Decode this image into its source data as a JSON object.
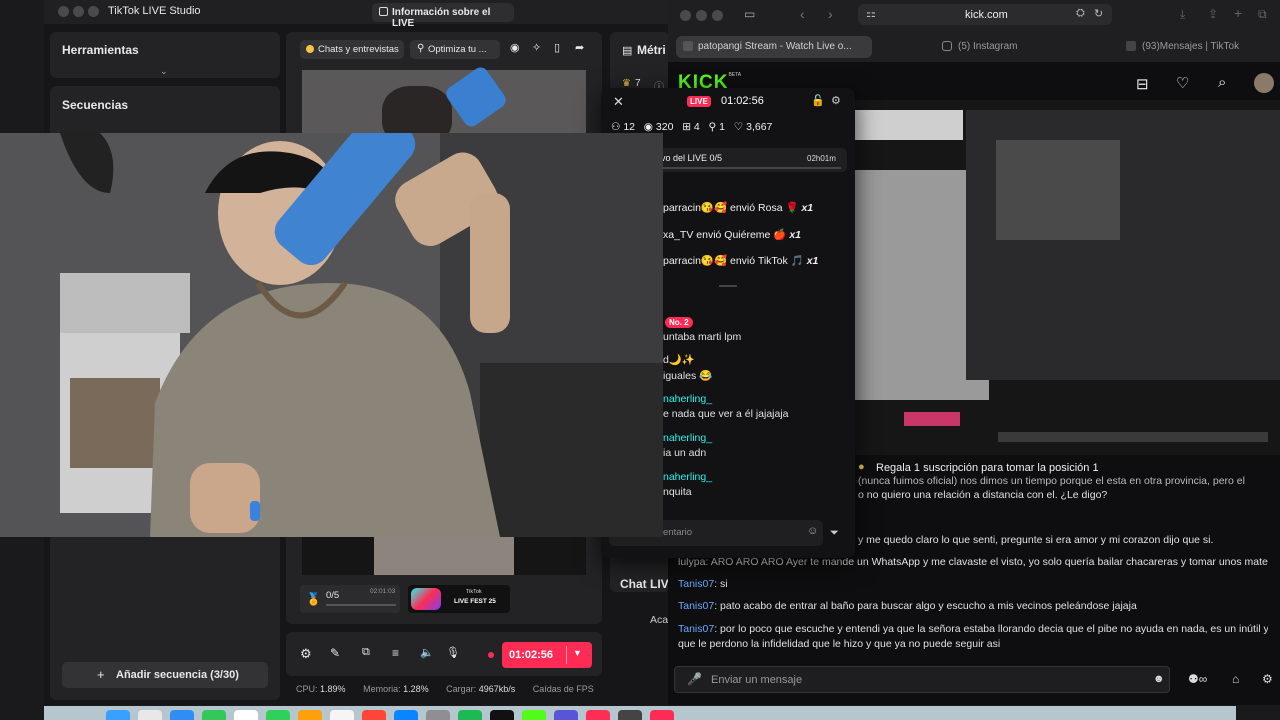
{
  "studio": {
    "title": "TikTok LIVE Studio",
    "info_button": "Información sobre el LIVE",
    "tools_title": "Herramientas",
    "sequences_title": "Secuencias",
    "add_sequence": "Añadir secuencia (3/30)",
    "tab_chats": "Chats y entrevistas",
    "tab_optimize": "Optimiza tu ...",
    "metrics_title": "Métri",
    "metrics_value": "7",
    "goal_progress": "0/5",
    "goal_time": "02:01:03",
    "fest_badge_top": "TikTok",
    "fest_badge": "LIVE FEST 25",
    "timer": "01:02:56",
    "cpu_label": "CPU:",
    "cpu_value": "1.89%",
    "mem_label": "Memoria:",
    "mem_value": "1.28%",
    "load_label": "Cargar:",
    "load_value": "4967kb/s",
    "drops_label": "Caídas de FPS",
    "chat_live_label": "Chat LIV",
    "chat_live_sub": "Aca"
  },
  "popup": {
    "live_badge": "LIVE",
    "timer": "01:02:56",
    "stats": {
      "followers": "12",
      "viewers": "320",
      "gifts": "4",
      "joined": "1",
      "likes": "3,667"
    },
    "goal_label": "vo del LIVE 0/5",
    "goal_time": "02h01m",
    "gifts": [
      {
        "text": "parracin😘🥰 envió Rosa",
        "emoji": "🌹",
        "count": "x1"
      },
      {
        "text": "xa_TV envió Quiéreme",
        "emoji": "🍎",
        "count": "x1"
      },
      {
        "text": "parracin😘🥰 envió TikTok",
        "emoji": "🎵",
        "count": "x1"
      }
    ],
    "rank_badge": "No. 2",
    "comments": [
      {
        "user": "",
        "text": "untaba marti lpm"
      },
      {
        "user": "",
        "text": "d🌙✨"
      },
      {
        "user": "",
        "text": "iguales 😂"
      },
      {
        "user": "naherling_",
        "text": "e nada que ver a él jajajaja"
      },
      {
        "user": "naherling_",
        "text": "ia un adn"
      },
      {
        "user": "naherling_",
        "text": "nquita"
      }
    ],
    "input_placeholder": "entario"
  },
  "browser": {
    "url": "kick.com",
    "tabs": [
      "patopangi Stream - Watch Live o...",
      "(5) Instagram",
      "(93)Mensajes | TikTok"
    ],
    "brand": "KICK",
    "brand_sup": "BETA",
    "pinned": "Regala 1 suscripción para tomar la posición 1",
    "chat": [
      {
        "user": "",
        "text": "(nunca fuimos oficial) nos dimos un tiempo porque el esta en otra provincia, pero el"
      },
      {
        "user": "",
        "text": "o no quiero una relación a distancia con el. ¿Le digo?"
      },
      {
        "user": "",
        "text": "y me quedo claro lo que senti, pregunte si era amor y mi corazon dijo que si."
      },
      {
        "user": "lulypa",
        "text": "ARO ARO ARO Ayer te mande un WhatsApp y me clavaste el visto, yo solo quería bailar chacareras y tomar unos matecitos."
      },
      {
        "user": "Tanis07",
        "text": "si"
      },
      {
        "user": "Tanis07",
        "text": "pato acabo de entrar al baño para buscar algo y escucho a mis vecinos peleándose jajaja"
      },
      {
        "user": "Tanis07",
        "text": "por lo poco que escuche y entendi ya que la señora estaba llorando decia que el pibe no ayuda en nada, es un inútil y"
      },
      {
        "user": "",
        "text": "que le perdono la infidelidad que le hizo y que ya no puede seguir asi"
      }
    ],
    "message_placeholder": "Enviar un mensaje"
  },
  "colors": {
    "tiktok_red": "#fe2c55",
    "kick_green": "#53fc18",
    "cyan": "#25f4ee"
  }
}
